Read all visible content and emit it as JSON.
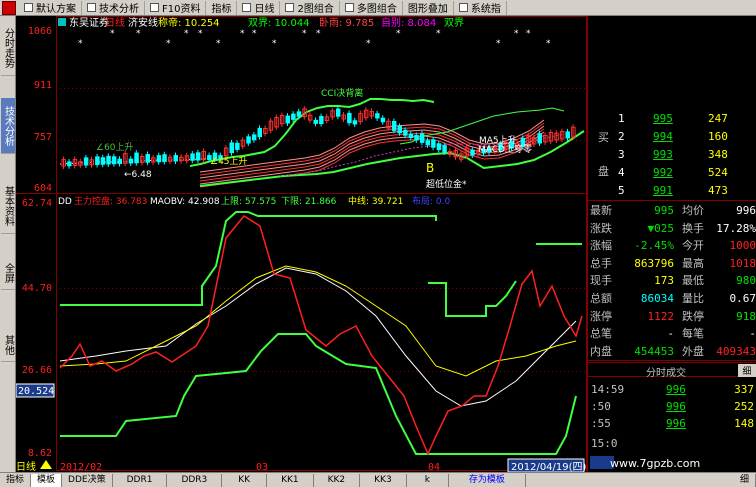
{
  "toolbar": {
    "items": [
      {
        "label": "默认方案"
      },
      {
        "label": "技术分析"
      },
      {
        "label": "F10资料"
      },
      {
        "label": "指标"
      },
      {
        "label": "日线"
      },
      {
        "label": "2图组合"
      },
      {
        "label": "多图组合"
      },
      {
        "label": "图形叠加"
      },
      {
        "label": "系统指"
      }
    ]
  },
  "sidebar": {
    "tabs": [
      {
        "label": "分时走势"
      },
      {
        "label": "技术分析"
      },
      {
        "label": "基本资料"
      },
      {
        "label": "全屏"
      },
      {
        "label": "其他"
      }
    ]
  },
  "price_chart": {
    "header": {
      "broker": "东吴证券",
      "period": "日线",
      "stock": "济安线",
      "items": [
        {
          "label": "称帝: 10.254"
        },
        {
          "label": "双界: 10.044"
        },
        {
          "label": "卧雨: 9.785"
        },
        {
          "label": "自别: 8.084"
        },
        {
          "label": "双界"
        }
      ]
    },
    "y_ticks": [
      "1066",
      "911",
      "757",
      "604"
    ],
    "annotations": {
      "cci": "CCI决背离",
      "ma45": "∠45上升",
      "ma60": "∠60上升",
      "low_price": "←6.48",
      "bottom_gold": "超低位金*",
      "ma5_up": "MA5上升",
      "macd_up": "MACD上穿零",
      "marker_b": "B"
    }
  },
  "indicator_chart": {
    "name": "DD",
    "items": [
      {
        "label": "王力控盘: 36.783"
      },
      {
        "label": "MAOBV: 42.908"
      },
      {
        "label": "上限: 57.575"
      },
      {
        "label": "下限: 21.866"
      },
      {
        "label": "中线: 39.721"
      },
      {
        "label": "布局: 0.0"
      }
    ],
    "y_ticks": [
      "62.74",
      "44.70",
      "26.66",
      "8.62"
    ],
    "cursor_value": "20.524"
  },
  "date_axis": {
    "period_label": "日线",
    "labels": [
      "2012/02",
      "03",
      "04"
    ],
    "current_date": "2012/04/19(四)"
  },
  "order_book": {
    "buy_label": "买",
    "sell_label": "盘",
    "rows": [
      {
        "level": "1",
        "price": "995",
        "volume": "247"
      },
      {
        "level": "2",
        "price": "994",
        "volume": "160"
      },
      {
        "level": "3",
        "price": "993",
        "volume": "348"
      },
      {
        "level": "4",
        "price": "992",
        "volume": "524"
      },
      {
        "level": "5",
        "price": "991",
        "volume": "473"
      }
    ]
  },
  "quote": {
    "rows": [
      {
        "l1": "最新",
        "v1": "995",
        "l2": "均价",
        "v2": "996"
      },
      {
        "l1": "涨跌",
        "v1": "▼025",
        "l2": "换手",
        "v2": "17.28%"
      },
      {
        "l1": "涨幅",
        "v1": "-2.45%",
        "l2": "今开",
        "v2": "1000"
      },
      {
        "l1": "总手",
        "v1": "863796",
        "l2": "最高",
        "v2": "1018"
      },
      {
        "l1": "现手",
        "v1": "173",
        "l2": "最低",
        "v2": "980"
      },
      {
        "l1": "总额",
        "v1": "86034",
        "l2": "量比",
        "v2": "0.67"
      },
      {
        "l1": "涨停",
        "v1": "1122",
        "l2": "跌停",
        "v2": "918"
      },
      {
        "l1": "总笔",
        "v1": "-",
        "l2": "每笔",
        "v2": "-"
      },
      {
        "l1": "内盘",
        "v1": "454453",
        "l2": "外盘",
        "v2": "409343"
      }
    ]
  },
  "ticks": {
    "title": "分时成交",
    "detail_button": "细",
    "rows": [
      {
        "time": "14:59",
        "price": "996",
        "volume": "337"
      },
      {
        "time": ":50",
        "price": "996",
        "volume": "252"
      },
      {
        "time": ":55",
        "price": "996",
        "volume": "148"
      }
    ],
    "last_time": "15:0"
  },
  "watermark": "www.7gpzb.com",
  "bottom_tabs": [
    {
      "label": "指标"
    },
    {
      "label": "模板"
    },
    {
      "label": "DDE决策"
    },
    {
      "label": "DDR1"
    },
    {
      "label": "DDR3"
    },
    {
      "label": "KK"
    },
    {
      "label": "KK1"
    },
    {
      "label": "KK2"
    },
    {
      "label": "KK3"
    },
    {
      "label": "k"
    },
    {
      "label": "存为模板"
    },
    {
      "label": "细"
    }
  ],
  "colors": {
    "up": "#ff2020",
    "down": "#00e000",
    "yellow": "#ffff00",
    "cyan": "#00ffff",
    "magenta": "#ff00ff",
    "grid_red": "#800000",
    "green_bright": "#40ff40",
    "white": "#ffffff"
  }
}
